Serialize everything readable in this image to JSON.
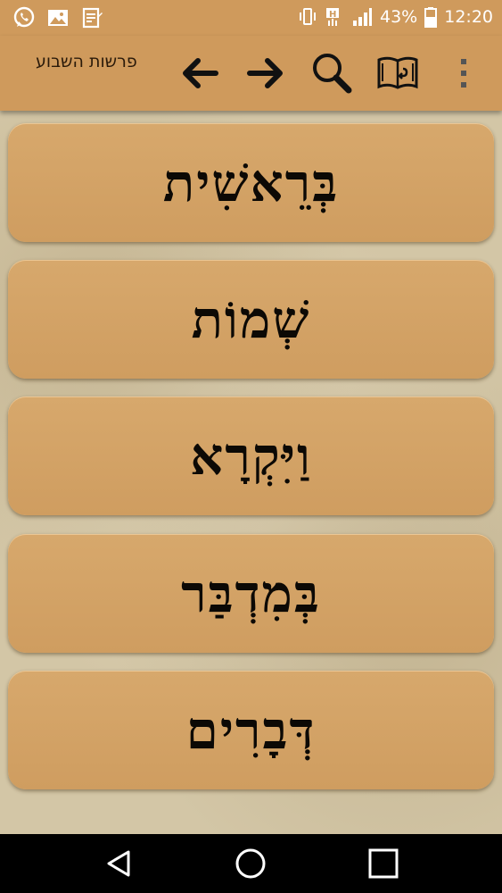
{
  "status_bar": {
    "battery_percent": "43%",
    "time": "12:20",
    "left_icons": [
      "whatsapp-icon",
      "gallery-icon",
      "notes-icon"
    ],
    "right_icons": [
      "vibrate-icon",
      "network-h-icon",
      "signal-icon",
      "battery-icon"
    ]
  },
  "toolbar": {
    "title": "פרשות השבוע",
    "icons": [
      "back-arrow-icon",
      "forward-arrow-icon",
      "search-icon",
      "book-icon",
      "overflow-menu-icon"
    ]
  },
  "books": [
    {
      "label": "בְּרֵאשִׁית"
    },
    {
      "label": "שְׁמוֹת"
    },
    {
      "label": "וַיִּקְרָא"
    },
    {
      "label": "בְּמִדְבַּר"
    },
    {
      "label": "דְּבָרִים"
    }
  ],
  "nav_bar": {
    "icons": [
      "back-triangle-icon",
      "home-circle-icon",
      "recents-square-icon"
    ]
  },
  "colors": {
    "toolbar": "#cf9a5c",
    "card": "#d4a366",
    "background": "#d3c6a6"
  }
}
